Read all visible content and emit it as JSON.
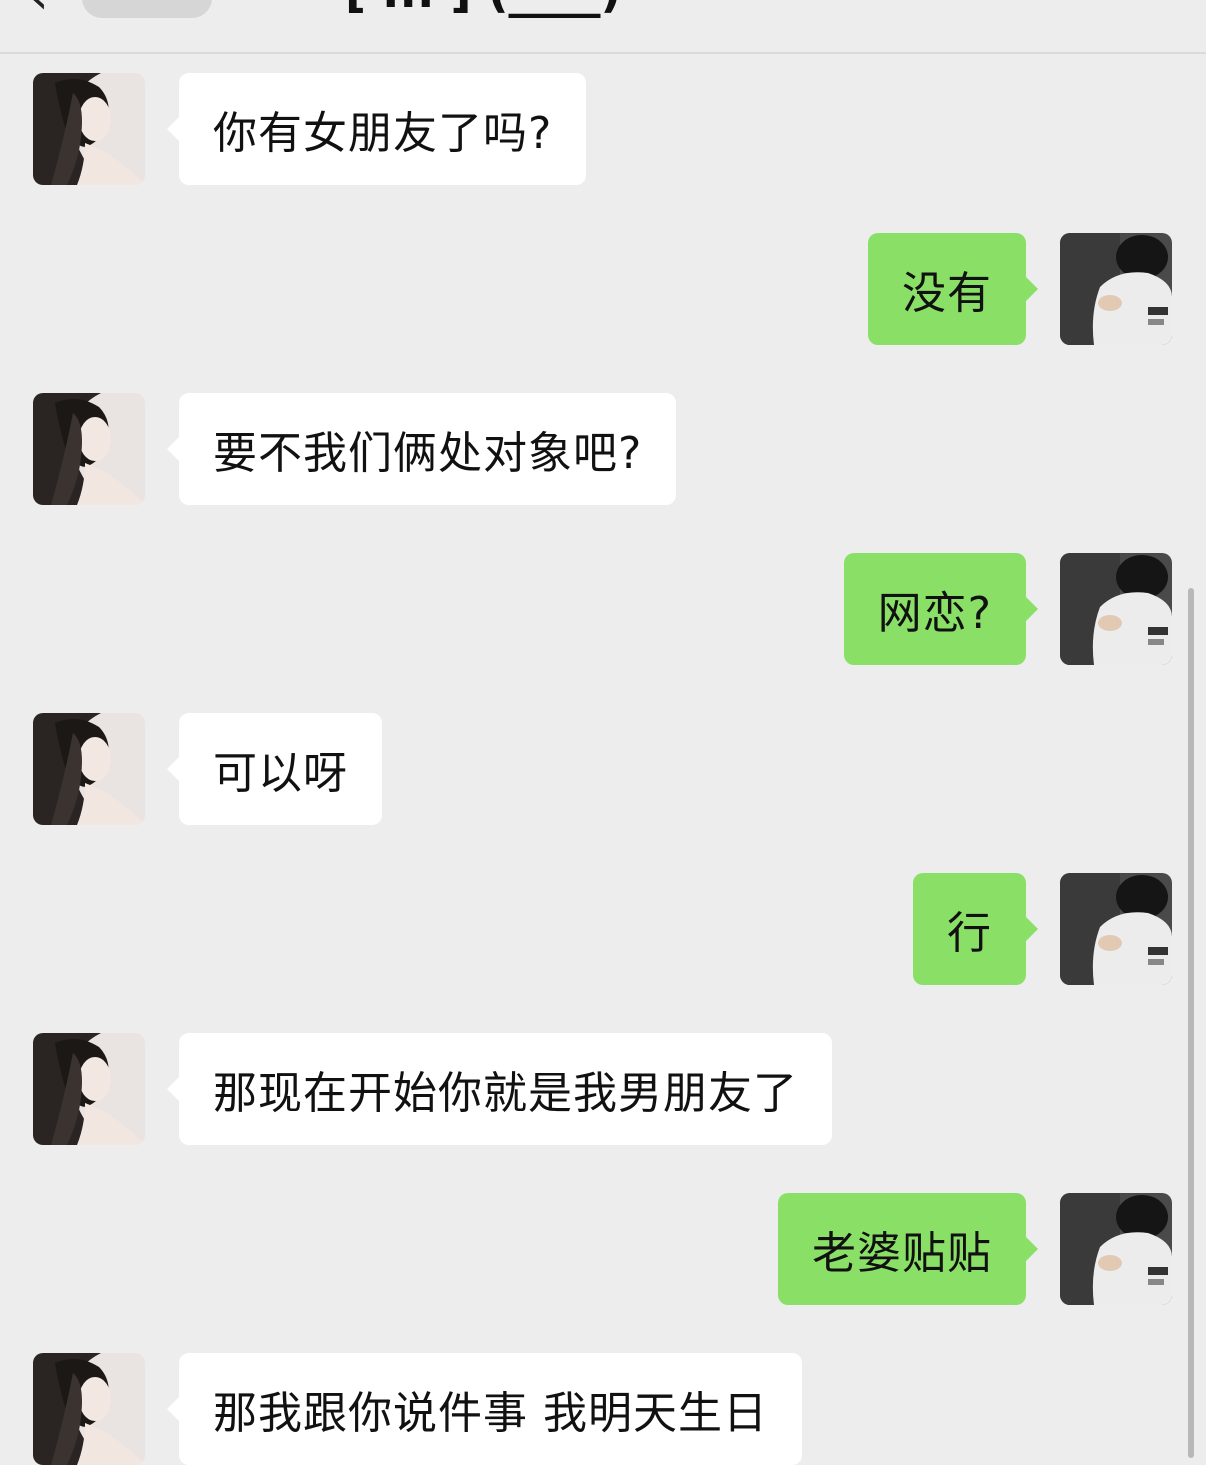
{
  "header": {
    "back_icon": "chevron-left-icon",
    "title": "[ ... ] (____)"
  },
  "colors": {
    "background": "#ededed",
    "incoming_bubble": "#ffffff",
    "outgoing_bubble": "#8ae067",
    "text": "#111111"
  },
  "messages": [
    {
      "sender": "other",
      "text": "你有女朋友了吗?"
    },
    {
      "sender": "me",
      "text": "没有"
    },
    {
      "sender": "other",
      "text": "要不我们俩处对象吧?"
    },
    {
      "sender": "me",
      "text": "网恋?"
    },
    {
      "sender": "other",
      "text": "可以呀"
    },
    {
      "sender": "me",
      "text": "行"
    },
    {
      "sender": "other",
      "text": "那现在开始你就是我男朋友了"
    },
    {
      "sender": "me",
      "text": "老婆贴贴"
    },
    {
      "sender": "other",
      "text": "那我跟你说件事 我明天生日"
    }
  ]
}
